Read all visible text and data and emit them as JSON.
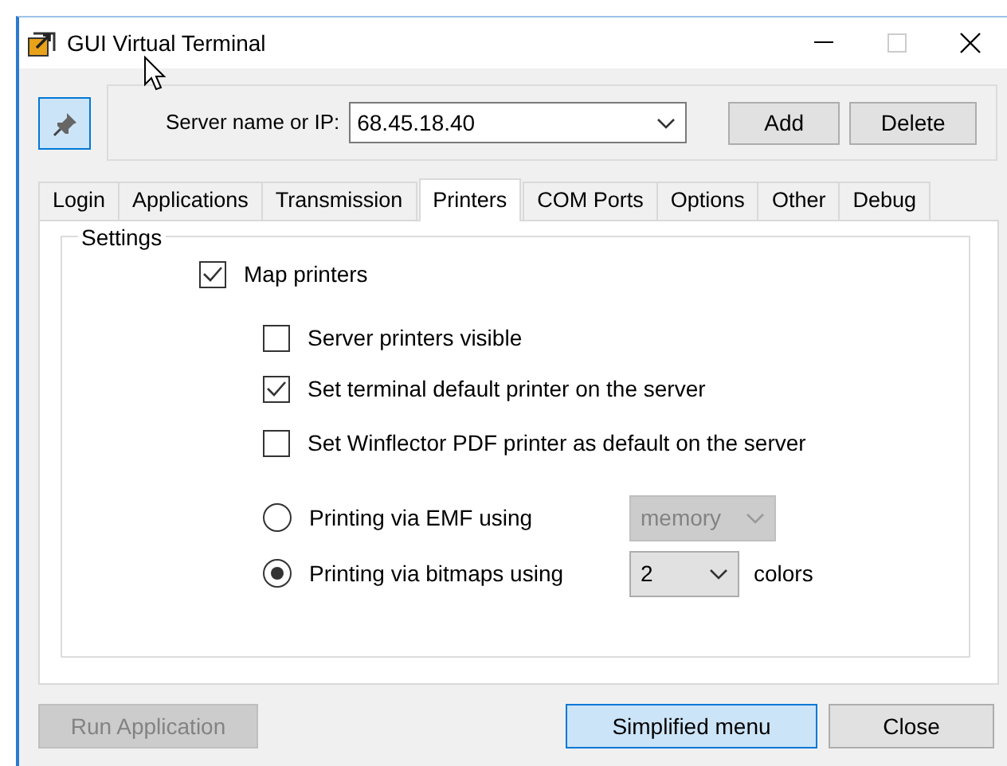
{
  "window": {
    "title": "GUI Virtual Terminal"
  },
  "toolbar": {
    "pin_pressed": true,
    "server_label": "Server name or IP:",
    "server_value": "68.45.18.40",
    "buttons": [
      "Add",
      "Delete"
    ]
  },
  "tabs": [
    {
      "label": "Login",
      "selected": false
    },
    {
      "label": "Applications",
      "selected": false
    },
    {
      "label": "Transmission",
      "selected": false
    },
    {
      "label": "Printers",
      "selected": true
    },
    {
      "label": "COM Ports",
      "selected": false
    },
    {
      "label": "Options",
      "selected": false
    },
    {
      "label": "Other",
      "selected": false
    },
    {
      "label": "Debug",
      "selected": false
    }
  ],
  "settings": {
    "legend": "Settings",
    "options": [
      {
        "kind": "checkbox",
        "label": "Map printers",
        "checked": true,
        "children": [
          {
            "kind": "checkbox",
            "label": "Server printers visible",
            "checked": false
          },
          {
            "kind": "checkbox",
            "label": "Set terminal default printer on the server",
            "checked": true
          },
          {
            "kind": "checkbox",
            "label": "Set Winflector PDF printer as default on the server",
            "checked": false
          },
          {
            "kind": "radio",
            "label": "Printing via EMF using",
            "checked": false,
            "select": {
              "value": "memory",
              "disabled": true
            }
          },
          {
            "kind": "radio",
            "label": "Printing via bitmaps using",
            "checked": true,
            "select": {
              "value": "2",
              "disabled": false
            },
            "suffix": "colors"
          }
        ]
      }
    ]
  },
  "footer": [
    {
      "label": "Run Application",
      "disabled": true,
      "default": false
    },
    {
      "label": "Simplified menu",
      "disabled": false,
      "default": true
    },
    {
      "label": "Close",
      "disabled": false,
      "default": false
    }
  ]
}
